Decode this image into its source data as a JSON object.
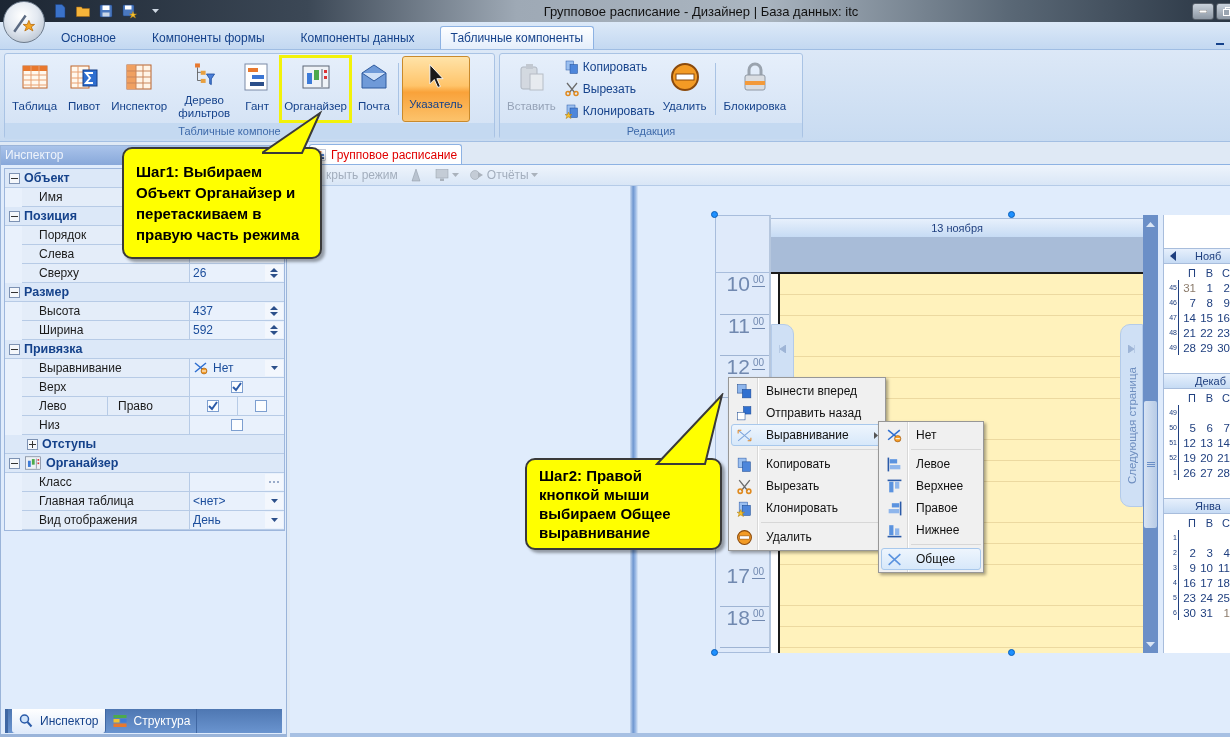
{
  "window": {
    "title": "Групповое расписание - Дизайнер | База данных: itc"
  },
  "ribbon": {
    "tabs": [
      {
        "label": "Основное",
        "selected": false
      },
      {
        "label": "Компоненты формы",
        "selected": false
      },
      {
        "label": "Компоненты данных",
        "selected": false
      },
      {
        "label": "Табличные компоненты",
        "selected": true
      }
    ],
    "groups": [
      {
        "label": "Табличные компоне",
        "items": [
          {
            "kind": "large",
            "label": "Таблица",
            "disabled": false,
            "highlighted": false
          },
          {
            "kind": "large",
            "label": "Пивот",
            "disabled": false,
            "highlighted": false
          },
          {
            "kind": "large",
            "label": "Инспектор",
            "disabled": false,
            "highlighted": false
          },
          {
            "kind": "large",
            "label": "Дерево фильтров",
            "disabled": false,
            "highlighted": false
          },
          {
            "kind": "large",
            "label": "Гант",
            "disabled": false,
            "highlighted": false
          },
          {
            "kind": "large",
            "label": "Органайзер",
            "disabled": false,
            "highlighted": true
          },
          {
            "kind": "large",
            "label": "Почта",
            "disabled": false,
            "highlighted": false
          },
          {
            "kind": "separator"
          },
          {
            "kind": "toggle",
            "label": "Указатель",
            "pressed": true
          }
        ]
      },
      {
        "label": "Редакция",
        "items": [
          {
            "kind": "large",
            "label": "Вставить",
            "disabled": true,
            "highlighted": false
          },
          {
            "kind": "stack",
            "items": [
              {
                "label": "Копировать"
              },
              {
                "label": "Вырезать"
              },
              {
                "label": "Клонировать"
              }
            ]
          },
          {
            "kind": "large",
            "label": "Удалить",
            "disabled": false,
            "highlighted": false
          },
          {
            "kind": "separator"
          },
          {
            "kind": "large",
            "label": "Блокировка",
            "disabled": false,
            "highlighted": false
          }
        ]
      }
    ]
  },
  "inspector": {
    "title": "Инспектор",
    "rows": [
      {
        "kind": "category",
        "label": "Объект",
        "expanded": true
      },
      {
        "kind": "text",
        "name": "Имя"
      },
      {
        "kind": "category",
        "label": "Позиция",
        "expanded": true
      },
      {
        "kind": "text",
        "name": "Порядок"
      },
      {
        "kind": "text",
        "name": "Слева"
      },
      {
        "kind": "spin",
        "name": "Сверху",
        "value": "26"
      },
      {
        "kind": "category",
        "label": "Размер",
        "expanded": true
      },
      {
        "kind": "spin",
        "name": "Высота",
        "value": "437"
      },
      {
        "kind": "spin",
        "name": "Ширина",
        "value": "592"
      },
      {
        "kind": "category",
        "label": "Привязка",
        "expanded": true
      },
      {
        "kind": "icon_dropdown",
        "name": "Выравнивание",
        "value": "Нет"
      },
      {
        "kind": "checkbox",
        "name": "Верх",
        "checked": true
      },
      {
        "kind": "checkbox_pair",
        "name": "Лево",
        "name_2": "Право",
        "checked": true,
        "checked_2": false
      },
      {
        "kind": "checkbox",
        "name": "Низ",
        "checked": false
      },
      {
        "kind": "subcategory",
        "label": "Отступы",
        "expanded": false
      },
      {
        "kind": "component_category",
        "label": "Органайзер",
        "expanded": true
      },
      {
        "kind": "ellipsis",
        "name": "Класс"
      },
      {
        "kind": "dropdown",
        "name": "Главная таблица",
        "value": "<нет>"
      },
      {
        "kind": "dropdown",
        "name": "Вид отображения",
        "value": "День"
      }
    ],
    "tabs": [
      {
        "label": "Инспектор",
        "selected": true
      },
      {
        "label": "Структура",
        "selected": false
      }
    ]
  },
  "document": {
    "tabs": [
      {
        "label": "Групповое расписание",
        "selected": true
      }
    ],
    "toolbar": {
      "close_mode": {
        "label": "крыть режим",
        "disabled": true
      },
      "reports": {
        "label": "Отчёты",
        "disabled": true
      }
    }
  },
  "organizer": {
    "date_header": "13 ноября",
    "time_column": {
      "upper": [
        {
          "hour": "10",
          "minutes": "00"
        },
        {
          "hour": "11",
          "minutes": "00"
        },
        {
          "hour": "12",
          "minutes": "00"
        }
      ],
      "lower": [
        {
          "hour": "17",
          "minutes": "00"
        },
        {
          "hour": "18",
          "minutes": "00"
        }
      ]
    },
    "next_page_tab": "Следующая страница",
    "mini_calendar": {
      "months": [
        {
          "title": "Нояб",
          "prev_arrow": true,
          "day_names": [
            "П",
            "В",
            "С"
          ],
          "weeks": [
            {
              "number": "45",
              "days": [
                {
                  "text": "31",
                  "adjacent": true
                },
                {
                  "text": "1",
                  "adjacent": false
                },
                {
                  "text": "2",
                  "adjacent": false
                }
              ]
            },
            {
              "number": "46",
              "days": [
                {
                  "text": "7",
                  "adjacent": false
                },
                {
                  "text": "8",
                  "adjacent": false
                },
                {
                  "text": "9",
                  "adjacent": false
                }
              ]
            },
            {
              "number": "47",
              "days": [
                {
                  "text": "14",
                  "adjacent": false
                },
                {
                  "text": "15",
                  "adjacent": false
                },
                {
                  "text": "16",
                  "adjacent": false
                }
              ]
            },
            {
              "number": "48",
              "days": [
                {
                  "text": "21",
                  "adjacent": false
                },
                {
                  "text": "22",
                  "adjacent": false
                },
                {
                  "text": "23",
                  "adjacent": false
                }
              ]
            },
            {
              "number": "49",
              "days": [
                {
                  "text": "28",
                  "adjacent": false
                },
                {
                  "text": "29",
                  "adjacent": false
                },
                {
                  "text": "30",
                  "adjacent": false
                }
              ]
            }
          ]
        },
        {
          "title": "Декаб",
          "prev_arrow": false,
          "day_names": [
            "П",
            "В",
            "С"
          ],
          "weeks": [
            {
              "number": "49"
            },
            {
              "number": "50",
              "days": [
                {
                  "text": "5",
                  "adjacent": false
                },
                {
                  "text": "6",
                  "adjacent": false
                },
                {
                  "text": "7",
                  "adjacent": false
                }
              ]
            },
            {
              "number": "51",
              "days": [
                {
                  "text": "12",
                  "adjacent": false
                },
                {
                  "text": "13",
                  "adjacent": false
                },
                {
                  "text": "14",
                  "adjacent": false
                }
              ]
            },
            {
              "number": "52",
              "days": [
                {
                  "text": "19",
                  "adjacent": false
                },
                {
                  "text": "20",
                  "adjacent": false
                },
                {
                  "text": "21",
                  "adjacent": false
                }
              ]
            },
            {
              "number": "1",
              "days": [
                {
                  "text": "26",
                  "adjacent": false
                },
                {
                  "text": "27",
                  "adjacent": false
                },
                {
                  "text": "28",
                  "adjacent": false
                }
              ]
            }
          ]
        },
        {
          "title": "Янва",
          "prev_arrow": false,
          "day_names": [
            "П",
            "В",
            "С"
          ],
          "weeks": [
            {
              "number": "1"
            },
            {
              "number": "2",
              "days": [
                {
                  "text": "2",
                  "adjacent": false
                },
                {
                  "text": "3",
                  "adjacent": false
                },
                {
                  "text": "4",
                  "adjacent": false
                }
              ]
            },
            {
              "number": "3",
              "days": [
                {
                  "text": "9",
                  "adjacent": false
                },
                {
                  "text": "10",
                  "adjacent": false
                },
                {
                  "text": "11",
                  "adjacent": false
                }
              ]
            },
            {
              "number": "4",
              "days": [
                {
                  "text": "16",
                  "adjacent": false
                },
                {
                  "text": "17",
                  "adjacent": false
                },
                {
                  "text": "18",
                  "adjacent": false
                }
              ]
            },
            {
              "number": "5",
              "days": [
                {
                  "text": "23",
                  "adjacent": false
                },
                {
                  "text": "24",
                  "adjacent": false
                },
                {
                  "text": "25",
                  "adjacent": false
                }
              ]
            },
            {
              "number": "6",
              "days": [
                {
                  "text": "30",
                  "adjacent": false
                },
                {
                  "text": "31",
                  "adjacent": false
                },
                {
                  "text": "1",
                  "adjacent": true
                }
              ]
            }
          ]
        }
      ]
    }
  },
  "context_menu": {
    "items": [
      {
        "kind": "item",
        "label": "Вынести вперед",
        "selected": false
      },
      {
        "kind": "item",
        "label": "Отправить назад",
        "selected": false
      },
      {
        "kind": "submenu",
        "label": "Выравнивание",
        "selected": true
      },
      {
        "kind": "separator"
      },
      {
        "kind": "item",
        "label": "Копировать",
        "selected": false
      },
      {
        "kind": "item",
        "label": "Вырезать",
        "selected": false
      },
      {
        "kind": "item",
        "label": "Клонировать",
        "selected": false
      },
      {
        "kind": "separator"
      },
      {
        "kind": "item",
        "label": "Удалить",
        "selected": false
      }
    ],
    "submenu": [
      {
        "kind": "item",
        "label": "Нет",
        "selected": false
      },
      {
        "kind": "separator"
      },
      {
        "kind": "item",
        "label": "Левое",
        "selected": false
      },
      {
        "kind": "item",
        "label": "Верхнее",
        "selected": false
      },
      {
        "kind": "item",
        "label": "Правое",
        "selected": false
      },
      {
        "kind": "item",
        "label": "Нижнее",
        "selected": false
      },
      {
        "kind": "separator"
      },
      {
        "kind": "item",
        "label": "Общее",
        "selected": true
      }
    ]
  },
  "callouts": [
    {
      "text": "Шаг1: Выбираем Объект Органайзер и перетаскиваем в правую часть режима"
    },
    {
      "text": "Шаг2: Правой кнопкой мыши выбираем Общее выравнивание"
    }
  ]
}
